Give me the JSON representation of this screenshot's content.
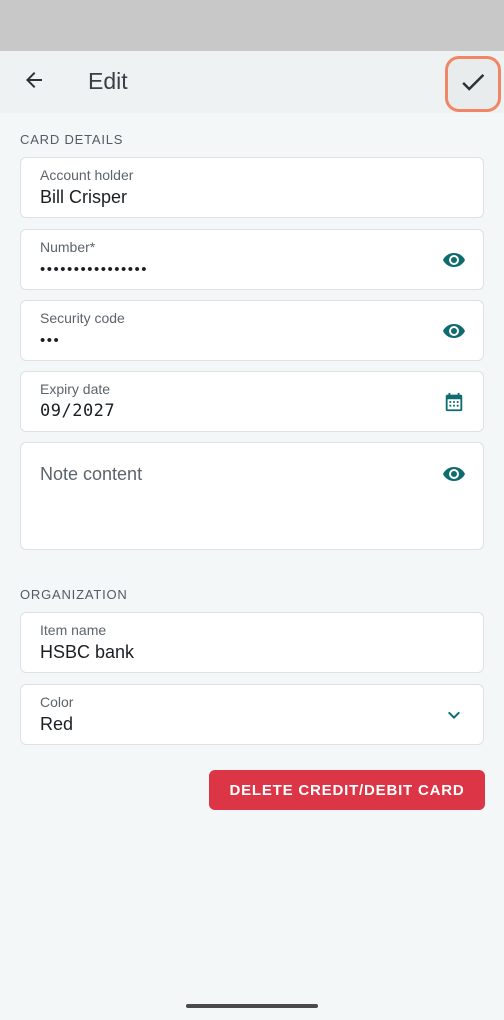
{
  "app_bar": {
    "title": "Edit"
  },
  "sections": {
    "card_details": "CARD DETAILS",
    "organization": "ORGANIZATION"
  },
  "fields": {
    "account_holder": {
      "label": "Account holder",
      "value": "Bill Crisper"
    },
    "number": {
      "label": "Number*",
      "value": "••••••••••••••••"
    },
    "security_code": {
      "label": "Security code",
      "value": "•••"
    },
    "expiry_date": {
      "label": "Expiry date",
      "value": "09/2027"
    },
    "note": {
      "placeholder": "Note content"
    },
    "item_name": {
      "label": "Item name",
      "value": "HSBC bank"
    },
    "color": {
      "label": "Color",
      "value": "Red"
    }
  },
  "actions": {
    "delete_label": "DELETE CREDIT/DEBIT CARD"
  },
  "colors": {
    "accent": "#0f6b6f",
    "danger": "#dc3546",
    "highlight": "#f08666"
  },
  "icons": {
    "back": "arrow-back-icon",
    "save": "check-icon",
    "reveal": "eye-icon",
    "calendar": "calendar-icon",
    "dropdown": "chevron-down-icon"
  }
}
